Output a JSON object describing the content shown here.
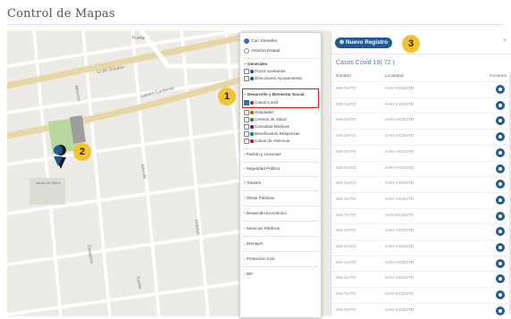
{
  "page": {
    "title": "Control de Mapas"
  },
  "map": {
    "street_labels": [
      "Fuerte",
      "12 de Octubre",
      "Lazaro Cardenas",
      "Morelos",
      "Allende",
      "Zaragoza",
      "Juarez",
      "Hidalgo"
    ],
    "park_label": "Jardin de Niños"
  },
  "layers": {
    "base": [
      {
        "label": "Carr Streetfire",
        "selected": true
      },
      {
        "label": "Ortofoto Estatal",
        "selected": false
      }
    ],
    "groups": [
      {
        "header": "Generales",
        "items": [
          {
            "label": "Pozos Sanitarios",
            "checked": false,
            "color": "#1e5a96"
          },
          {
            "label": "Direcciones Ayuntamiento",
            "checked": false,
            "color": "#1e5a96"
          }
        ]
      },
      {
        "header": "Desarrollo y Bienestar Social",
        "items": [
          {
            "label": "Casos Covid",
            "checked": true,
            "color": "#c62828"
          },
          {
            "label": "Hospitales",
            "checked": false,
            "color": "#d35400"
          },
          {
            "label": "Centros de Salud",
            "checked": false,
            "color": "#2e7d32"
          },
          {
            "label": "Consultas Medicas",
            "checked": false,
            "color": "#6a1b9a"
          },
          {
            "label": "Beneficiarios Despensas",
            "checked": false,
            "color": "#00838f"
          },
          {
            "label": "Casos de Violencia",
            "checked": false,
            "color": "#ad1457"
          }
        ]
      }
    ],
    "sections": [
      "Padrón y Licencias",
      "Seguridad Pública",
      "Tránsito",
      "Obras Públicas",
      "Desarrollo Económico",
      "Servicios Públicos",
      "Drenajes",
      "Protección Civil",
      "DIF"
    ]
  },
  "panel": {
    "new_button": "Nuevo Registro",
    "close": "×",
    "heading": "Casos Covid 19( 72 )",
    "columns": [
      "Nombre",
      "Localidad",
      "Acciones"
    ],
    "rows": [
      {
        "name": "SIN DATO",
        "locality": "SAN VICENTE"
      },
      {
        "name": "SIN DATO",
        "locality": "SAN VICENTE"
      },
      {
        "name": "SIN DATO",
        "locality": "SAN VICENTE"
      },
      {
        "name": "SIN DATO",
        "locality": "SAN VICENTE"
      },
      {
        "name": "SIN DATO",
        "locality": "SAN VICENTE"
      },
      {
        "name": "SIN DATO",
        "locality": "SAN VICENTE"
      },
      {
        "name": "SIN DATO",
        "locality": "SAN VICENTE"
      },
      {
        "name": "SIN DATO",
        "locality": "SAN VICENTE"
      },
      {
        "name": "SIN DATO",
        "locality": "SAN VICENTE"
      },
      {
        "name": "SIN DATO",
        "locality": "SAN VICENTE"
      },
      {
        "name": "SIN DATO",
        "locality": "SAN VICENTE"
      },
      {
        "name": "SIN DATO",
        "locality": "SAN VICENTE"
      },
      {
        "name": "SIN DATO",
        "locality": "SAN VICENTE"
      },
      {
        "name": "SIN DATO",
        "locality": "SAN VICENTE"
      },
      {
        "name": "SIN DATO",
        "locality": "SAN VICENTE"
      }
    ]
  },
  "badges": [
    "1",
    "2",
    "3"
  ],
  "colors": {
    "accent": "#1e5a96",
    "badge": "#f4c430",
    "highlight": "#e21b1b",
    "heading": "#4a7bb7"
  }
}
